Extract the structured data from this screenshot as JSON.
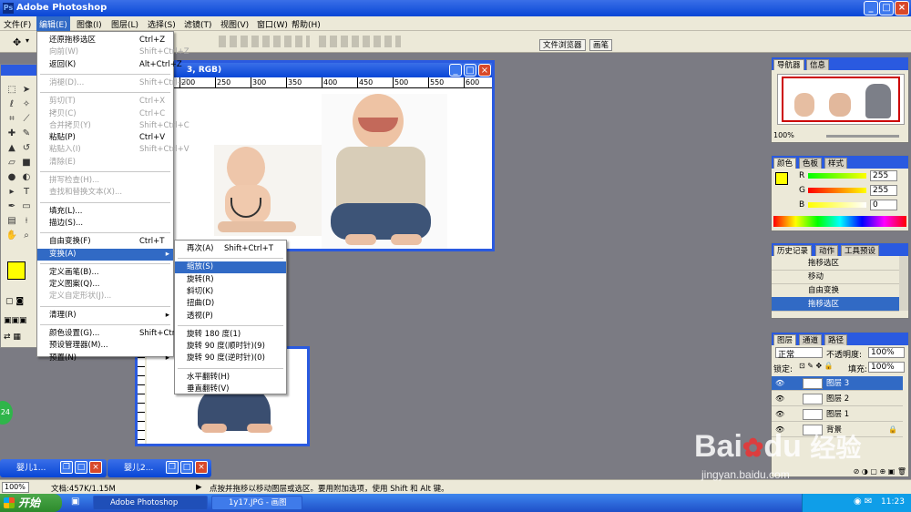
{
  "app": {
    "title": "Adobe Photoshop"
  },
  "menubar": [
    "文件(F)",
    "编辑(E)",
    "图像(I)",
    "图层(L)",
    "选择(S)",
    "滤镜(T)",
    "视图(V)",
    "窗口(W)",
    "帮助(H)"
  ],
  "optionbar": {
    "tab_file_browser": "文件浏览器",
    "tab_brushes": "画笔"
  },
  "edit_menu": [
    {
      "label": "还原拖移选区",
      "shortcut": "Ctrl+Z",
      "state": "normal"
    },
    {
      "label": "向前(W)",
      "shortcut": "Shift+Ctrl+Z",
      "state": "disabled"
    },
    {
      "label": "返回(K)",
      "shortcut": "Alt+Ctrl+Z",
      "state": "normal"
    },
    {
      "sep": true
    },
    {
      "label": "消褪(D)...",
      "shortcut": "Shift+Ctrl+F",
      "state": "disabled"
    },
    {
      "sep": true
    },
    {
      "label": "剪切(T)",
      "shortcut": "Ctrl+X",
      "state": "disabled"
    },
    {
      "label": "拷贝(C)",
      "shortcut": "Ctrl+C",
      "state": "disabled"
    },
    {
      "label": "合并拷贝(Y)",
      "shortcut": "Shift+Ctrl+C",
      "state": "disabled"
    },
    {
      "label": "粘贴(P)",
      "shortcut": "Ctrl+V",
      "state": "normal"
    },
    {
      "label": "粘贴入(I)",
      "shortcut": "Shift+Ctrl+V",
      "state": "disabled"
    },
    {
      "label": "清除(E)",
      "shortcut": "",
      "state": "disabled"
    },
    {
      "sep": true
    },
    {
      "label": "拼写检查(H)...",
      "shortcut": "",
      "state": "disabled"
    },
    {
      "label": "查找和替换文本(X)...",
      "shortcut": "",
      "state": "disabled"
    },
    {
      "sep": true
    },
    {
      "label": "填充(L)...",
      "shortcut": "",
      "state": "normal"
    },
    {
      "label": "描边(S)...",
      "shortcut": "",
      "state": "normal"
    },
    {
      "sep": true
    },
    {
      "label": "自由变换(F)",
      "shortcut": "Ctrl+T",
      "state": "normal"
    },
    {
      "label": "变换(A)",
      "shortcut": "",
      "state": "highlight",
      "submenu": true
    },
    {
      "sep": true
    },
    {
      "label": "定义画笔(B)...",
      "shortcut": "",
      "state": "normal"
    },
    {
      "label": "定义图案(Q)...",
      "shortcut": "",
      "state": "normal"
    },
    {
      "label": "定义自定形状(J)...",
      "shortcut": "",
      "state": "disabled"
    },
    {
      "sep": true
    },
    {
      "label": "清理(R)",
      "shortcut": "",
      "state": "normal",
      "submenu": true
    },
    {
      "sep": true
    },
    {
      "label": "颜色设置(G)...",
      "shortcut": "Shift+Ctrl+K",
      "state": "normal"
    },
    {
      "label": "预设管理器(M)...",
      "shortcut": "",
      "state": "normal"
    },
    {
      "label": "预置(N)",
      "shortcut": "",
      "state": "normal",
      "submenu": true
    }
  ],
  "transform_menu": [
    {
      "label": "再次(A)",
      "shortcut": "Shift+Ctrl+T",
      "state": "normal"
    },
    {
      "sep": true
    },
    {
      "label": "缩放(S)",
      "state": "highlight"
    },
    {
      "label": "旋转(R)",
      "state": "normal"
    },
    {
      "label": "斜切(K)",
      "state": "normal"
    },
    {
      "label": "扭曲(D)",
      "state": "normal"
    },
    {
      "label": "透视(P)",
      "state": "normal"
    },
    {
      "sep": true
    },
    {
      "label": "旋转 180 度(1)",
      "state": "normal"
    },
    {
      "label": "旋转 90 度(顺时针)(9)",
      "state": "normal"
    },
    {
      "label": "旋转 90 度(逆时针)(0)",
      "state": "normal"
    },
    {
      "sep": true
    },
    {
      "label": "水平翻转(H)",
      "state": "normal"
    },
    {
      "label": "垂直翻转(V)",
      "state": "normal"
    }
  ],
  "doc_main": {
    "title_suffix": "3, RGB)",
    "ruler": [
      "200",
      "250",
      "300",
      "350",
      "400",
      "450",
      "500",
      "550",
      "600"
    ]
  },
  "navigator": {
    "tabs": [
      "导航器",
      "信息"
    ],
    "zoom": "100%"
  },
  "color_panel": {
    "tabs": [
      "颜色",
      "色板",
      "样式"
    ],
    "r_label": "R",
    "g_label": "G",
    "b_label": "B",
    "r": "255",
    "g": "255",
    "b": "0",
    "fg": "#ffff00",
    "bg": "#00cc00"
  },
  "history": {
    "tabs": [
      "历史记录",
      "动作",
      "工具预设"
    ],
    "items": [
      "拖移选区",
      "移动",
      "自由变换",
      "拖移选区"
    ]
  },
  "layers": {
    "tabs": [
      "图层",
      "通道",
      "路径"
    ],
    "mode": "正常",
    "opacity_label": "不透明度:",
    "opacity": "100%",
    "lock_label": "锁定:",
    "fill_label": "填充:",
    "fill": "100%",
    "items": [
      "图层 3",
      "图层 2",
      "图层 1",
      "背景"
    ]
  },
  "minimized": [
    "婴儿1...",
    "婴儿2..."
  ],
  "status": {
    "zoom": "100%",
    "doc": "文档:457K/1.15M",
    "hint": "点按并拖移以移动图层或选区。要用附加选项，使用 Shift 和 Alt 键。"
  },
  "taskbar": {
    "start": "开始",
    "tasks": [
      "Adobe Photoshop",
      "1y17.JPG - 画图"
    ],
    "time": "11:23"
  },
  "badge": "24",
  "watermark": {
    "brand": "Bai",
    "brand2": "du",
    "jingyan": "经验",
    "url": "jingyan.baidu.com"
  }
}
